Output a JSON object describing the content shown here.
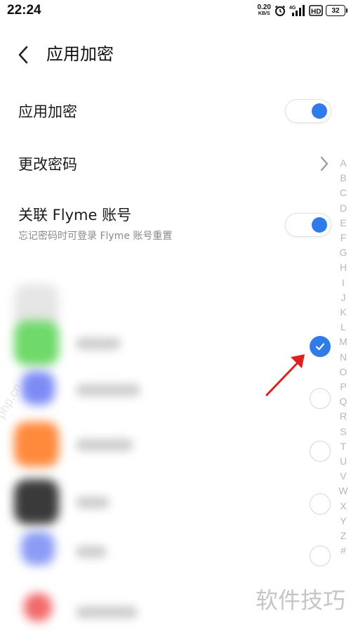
{
  "status_bar": {
    "time": "22:24",
    "net_speed_value": "0.20",
    "net_speed_unit": "KB/S",
    "network_type": "4G",
    "hd_label": "HD",
    "battery_level": "32",
    "icons": [
      "alarm-icon",
      "signal-icon",
      "hd-icon",
      "battery-icon"
    ]
  },
  "header": {
    "title": "应用加密"
  },
  "settings": {
    "app_lock": {
      "label": "应用加密",
      "enabled": true
    },
    "change_password": {
      "label": "更改密码"
    },
    "flyme_link": {
      "label": "关联 Flyme 账号",
      "subtitle": "忘记密码时可登录 Flyme 账号重置",
      "enabled": true
    }
  },
  "app_list": {
    "items": [
      {
        "checked": null,
        "icon_color": "#e6e6e6"
      },
      {
        "checked": true,
        "icon_color": "#6fd96a"
      },
      {
        "checked": false,
        "icon_color": "#7d8cf5"
      },
      {
        "checked": false,
        "icon_color": "#ff8a3d"
      },
      {
        "checked": false,
        "icon_color": "#3a3a3a"
      },
      {
        "checked": false,
        "icon_color": "#8b9cf6"
      },
      {
        "checked": null,
        "icon_color": "#f26a6a"
      }
    ]
  },
  "alphabet_index": [
    "A",
    "B",
    "C",
    "D",
    "E",
    "F",
    "G",
    "H",
    "I",
    "J",
    "K",
    "L",
    "M",
    "N",
    "O",
    "P",
    "Q",
    "R",
    "S",
    "T",
    "U",
    "V",
    "W",
    "X",
    "Y",
    "Z",
    "#"
  ],
  "watermark": {
    "footer": "软件技巧",
    "side": "php.cn"
  },
  "colors": {
    "accent": "#2f7bea",
    "annotation_arrow": "#e02020",
    "index_text": "#b7b7b7"
  }
}
